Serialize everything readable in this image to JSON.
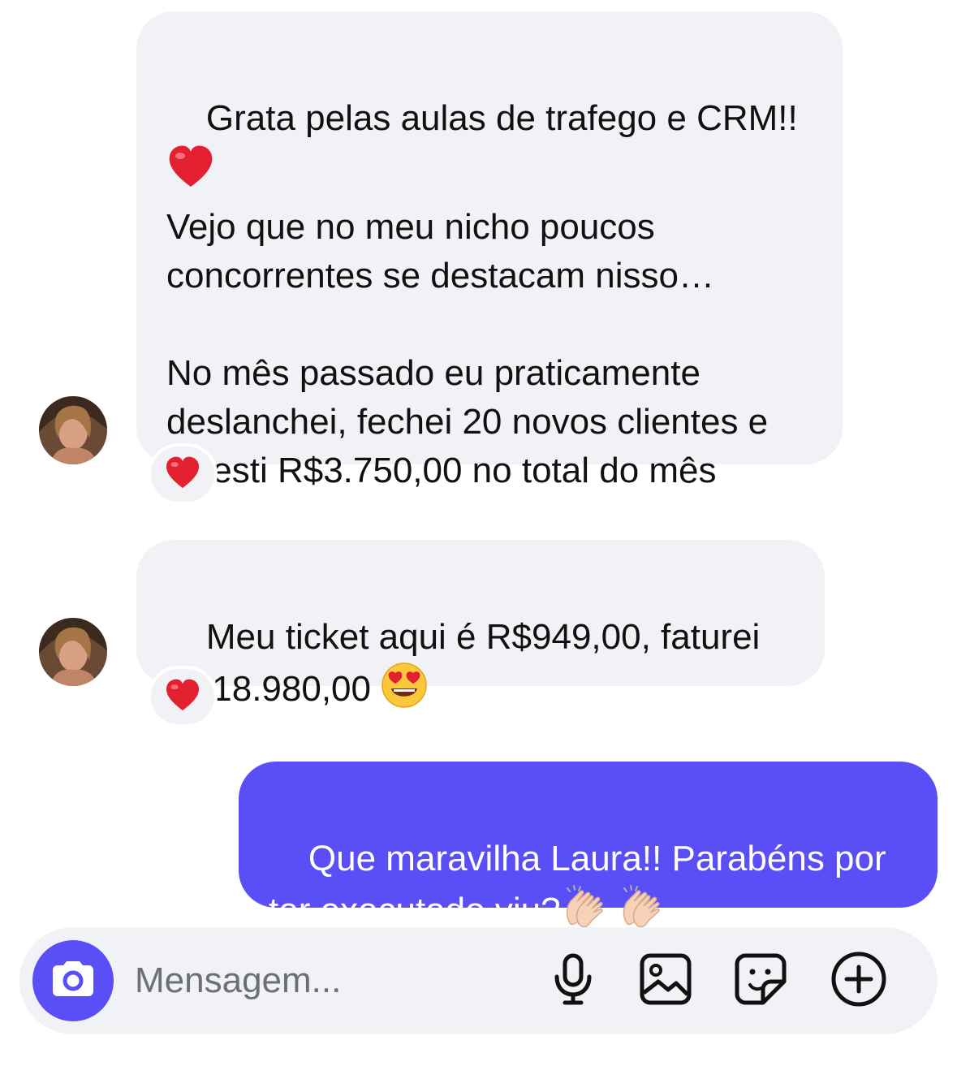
{
  "conversation": {
    "messages": [
      {
        "direction": "incoming",
        "text": "Grata pelas aulas de trafego e CRM!!",
        "text_after_emoji": "Vejo que no meu nicho poucos concorrentes se destacam nisso…\n\nNo mês passado eu praticamente deslanchei, fechei 20 novos clientes e investi R$3.750,00 no total do mês",
        "emoji": "heart-emoji",
        "reaction": "heart-emoji"
      },
      {
        "direction": "incoming",
        "text": "Meu ticket aqui é R$949,00, faturei R$18.980,00",
        "emoji": "heart-eyes-emoji",
        "reaction": "heart-emoji"
      },
      {
        "direction": "outgoing",
        "text": "Que maravilha Laura!! Parabéns por ter executado viu?",
        "emoji": "clapping-hands-emoji x2"
      }
    ]
  },
  "composer": {
    "placeholder": "Mensagem...",
    "tools": [
      "microphone-icon",
      "image-icon",
      "sticker-icon",
      "plus-circle-icon"
    ]
  },
  "colors": {
    "incoming_bubble": "#f1f2f5",
    "outgoing_bubble": "#5a4ff6",
    "heart": "#e3202f"
  }
}
